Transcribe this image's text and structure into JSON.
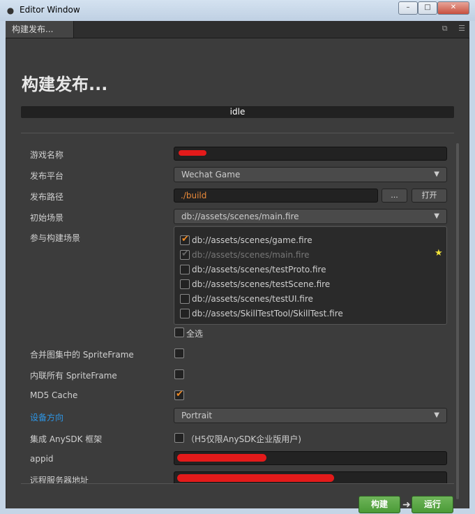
{
  "window": {
    "title": "Editor Window",
    "controls": [
      "–",
      "□",
      "✕"
    ]
  },
  "tab": {
    "label": "构建发布...",
    "icons": [
      "restore-icon",
      "menu-icon"
    ]
  },
  "heading": "构建发布...",
  "status": "idle",
  "form": {
    "game_name": {
      "label": "游戏名称"
    },
    "platform": {
      "label": "发布平台",
      "value": "Wechat Game"
    },
    "build_path": {
      "label": "发布路径",
      "value": "./build",
      "browse_label": "...",
      "open_label": "打开"
    },
    "start_scene": {
      "label": "初始场景",
      "value": "db://assets/scenes/main.fire"
    },
    "scenes": {
      "label": "参与构建场景",
      "items": [
        {
          "path": "db://assets/scenes/game.fire",
          "checked": true
        },
        {
          "path": "db://assets/scenes/main.fire",
          "checked": true,
          "disabled": true
        },
        {
          "path": "db://assets/scenes/testProto.fire",
          "checked": false
        },
        {
          "path": "db://assets/scenes/testScene.fire",
          "checked": false
        },
        {
          "path": "db://assets/scenes/testUI.fire",
          "checked": false
        },
        {
          "path": "db://assets/SkillTestTool/SkillTest.fire",
          "checked": false
        }
      ],
      "select_all": "全选"
    },
    "merge_sprite": {
      "label": "合并图集中的 SpriteFrame",
      "checked": false
    },
    "inline_sprite": {
      "label": "内联所有 SpriteFrame",
      "checked": false
    },
    "md5": {
      "label": "MD5 Cache",
      "checked": true
    },
    "orientation": {
      "label": "设备方向",
      "value": "Portrait"
    },
    "anysdk": {
      "label": "集成 AnySDK 框架",
      "note": "（H5仅限AnySDK企业版用户)",
      "checked": false
    },
    "appid": {
      "label": "appid"
    },
    "remote_server": {
      "label": "远程服务器地址"
    }
  },
  "footer": {
    "build_label": "构建",
    "run_label": "运行"
  },
  "colors": {
    "accent_orange": "#f08a24",
    "link_blue": "#2d96e6",
    "button_green": "#5aa845"
  }
}
